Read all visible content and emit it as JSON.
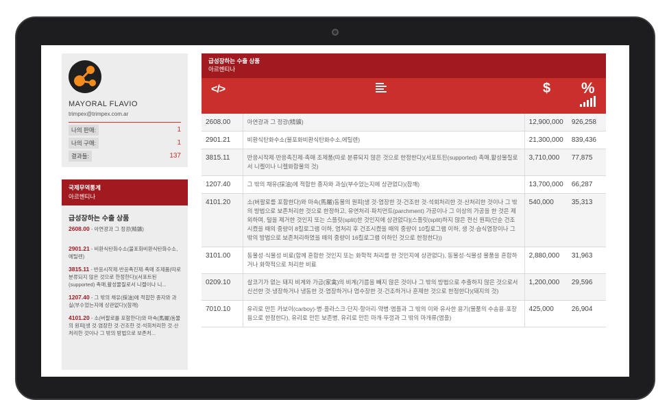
{
  "profile": {
    "name": "MAYORAL FLAVIO",
    "email": "trimpex@trimpex.com.ar",
    "stats": [
      {
        "label": "나의 판매:",
        "value": "1"
      },
      {
        "label": "나의 구매:",
        "value": "1"
      },
      {
        "label": "결과들:",
        "value": "137"
      }
    ]
  },
  "sidebar": {
    "head_title": "국제무역통계",
    "head_subtitle": "아르헨티나",
    "section_title": "급성장하는 수출 상품",
    "items": [
      {
        "code": "2608.00",
        "text": " - 아연광과 그 정광(精鑛)"
      },
      {
        "code": "2901.21",
        "text": " - 비환식탄화수소(불포화비환식탄화수소,에틸렌)"
      },
      {
        "code": "3815.11",
        "text": " - 반응시작제·반응촉진제·촉매 조제품(따로 분류되지 않은 것으로 한정한다)(서포트된(supported) 촉매,활성물질로서 니켈이나 니..."
      },
      {
        "code": "1207.40",
        "text": " - 그 밖의 채유(採油)에 적합한 종자와 과실(부수었는지에 상관없다)(참깨)"
      },
      {
        "code": "4101.20",
        "text": " - 소(버팔로를 포함한다)와 마속(馬屬)동물의 원피[생 것·염장한 것·건조한 것·석회처리한 것·산처리한 것이나 그 밖의 방법으로 보존처..."
      }
    ]
  },
  "main": {
    "title": "급성장하는 수출 상품",
    "subtitle": "아르헨티나",
    "icons": {
      "code": "</>",
      "price": "$",
      "percent": "%"
    },
    "rows": [
      {
        "code": "2608.00",
        "desc": "아연광과 그 정광(精鑛)",
        "price": "12,900,000",
        "pct": "926,258"
      },
      {
        "code": "2901.21",
        "desc": "비환식탄화수소(불포화비환식탄화수소,에틸렌)",
        "price": "21,300,000",
        "pct": "839,436"
      },
      {
        "code": "3815.11",
        "desc": "반응시작제·반응촉진제·촉매 조제품(따로 분류되지 않은 것으로 한정한다)(서포트된(supported) 촉매,활성물질로서 니켈이나 니켈화합물의 것)",
        "price": "3,710,000",
        "pct": "77,875"
      },
      {
        "code": "1207.40",
        "desc": "그 밖의 채유(採油)에 적합한 종자와 과실(부수었는지에 상관없다)(참깨)",
        "price": "13,700,000",
        "pct": "66,287"
      },
      {
        "code": "4101.20",
        "desc": "소(버팔로를 포함한다)와 마속(馬屬)동물의 원피[생 것·염장한 것·건조한 것·석회처리한 것·산처리한 것이나 그 밖의 방법으로 보존처리한 것으로 한정하고, 유연처리·파치먼트(parchment) 가공이나 그 이상의 가공을 한 것은 제외하며, 털을 제거한 것인지 또는 스플릿(split)한 것인지에 상관없다](스플릿(split)하지 않은 전신 원피(단순 건조시켰을 때의 중량이 8킬로그램 이하, 염처리 후 건조시켰을 때의 중량이 10킬로그램 이하, 생 것·습식염장이나 그 밖의 방법으로 보존처리하였을 때의 중량이 16킬로그램 이하인 것으로 한정한다))",
        "price": "540,000",
        "pct": "35,313"
      },
      {
        "code": "3101.00",
        "desc": "동물성·식물성 비료(함께 혼합한 것인지 또는 화학적 처리를 한 것인지에 상관없다), 동물성·식물성 물품을 혼합하거나 화학적으로 처리한 비료",
        "price": "2,880,000",
        "pct": "31,963"
      },
      {
        "code": "0209.10",
        "desc": "살코기가 없는 돼지 비계와 가금(家禽)의 비계(기름을 빼지 않은 것이나 그 밖의 방법으로 추출하지 않은 것으로서 신선한 것·냉장하거나 냉동한 것·염장하거나 염수장한 것·건조하거나 훈제한 것으로 한정한다)(돼지의 것)",
        "price": "1,200,000",
        "pct": "29,596"
      },
      {
        "code": "7010.10",
        "desc": "유리로 만든 카보이(carboy)·병·플라스크·단지·항아리·약병·앰플과 그 밖의 이와 유사한 용기(물품의 수송용·포장용으로 한정한다), 유리로 만든 보존병, 유리로 만든 마개·뚜껑과 그 밖의 마개류(앰플)",
        "price": "425,000",
        "pct": "26,904"
      }
    ]
  },
  "colors": {
    "accent": "#c9302c",
    "dark_accent": "#a11a20",
    "avatar_orange": "#f28c1c"
  }
}
